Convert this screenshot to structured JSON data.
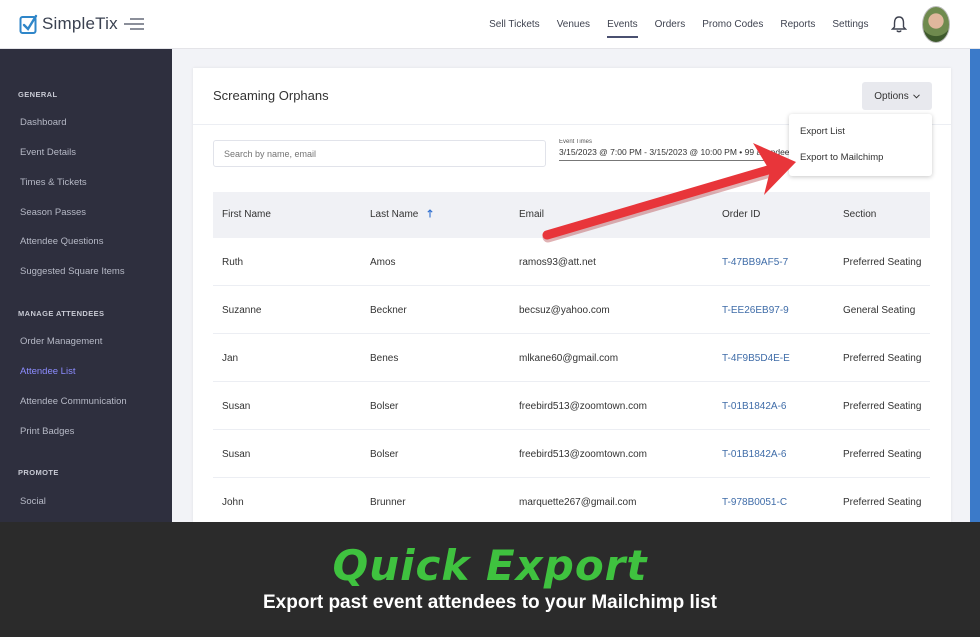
{
  "app": {
    "name": "SimpleTix"
  },
  "nav": {
    "items": [
      "Sell Tickets",
      "Venues",
      "Events",
      "Orders",
      "Promo Codes",
      "Reports",
      "Settings"
    ],
    "active": "Events"
  },
  "sidebar": {
    "sections": [
      {
        "title": "GENERAL",
        "items": [
          "Dashboard",
          "Event Details",
          "Times & Tickets",
          "Season Passes",
          "Attendee Questions",
          "Suggested Square Items"
        ]
      },
      {
        "title": "MANAGE ATTENDEES",
        "items": [
          "Order Management",
          "Attendee List",
          "Attendee Communication",
          "Print Badges"
        ]
      },
      {
        "title": "PROMOTE",
        "items": [
          "Social"
        ]
      }
    ],
    "active_item": "Attendee List"
  },
  "card": {
    "title": "Screaming Orphans",
    "options_label": "Options",
    "search_placeholder": "Search by name, email",
    "event_times_label": "Event Times",
    "event_times_value": "3/15/2023 @ 7:00 PM - 3/15/2023 @ 10:00 PM • 99 attendees"
  },
  "dropdown": {
    "items": [
      "Export List",
      "Export to Mailchimp"
    ]
  },
  "table": {
    "columns": [
      "First Name",
      "Last Name",
      "Email",
      "Order ID",
      "Section"
    ],
    "rows": [
      [
        "Ruth",
        "Amos",
        "ramos93@att.net",
        "T-47BB9AF5-7",
        "Preferred Seating"
      ],
      [
        "Suzanne",
        "Beckner",
        "becsuz@yahoo.com",
        "T-EE26EB97-9",
        "General Seating"
      ],
      [
        "Jan",
        "Benes",
        "mlkane60@gmail.com",
        "T-4F9B5D4E-E",
        "Preferred Seating"
      ],
      [
        "Susan",
        "Bolser",
        "freebird513@zoomtown.com",
        "T-01B1842A-6",
        "Preferred Seating"
      ],
      [
        "Susan",
        "Bolser",
        "freebird513@zoomtown.com",
        "T-01B1842A-6",
        "Preferred Seating"
      ],
      [
        "John",
        "Brunner",
        "marquette267@gmail.com",
        "T-978B0051-C",
        "Preferred Seating"
      ]
    ]
  },
  "banner": {
    "title": "Quick Export",
    "subtitle": "Export past event attendees to your Mailchimp list",
    "title_color": "#3fc23f"
  },
  "colors": {
    "sidebar_bg": "#2e2f3e",
    "accent_link": "#3f6ca8",
    "arrow": "#e8353a",
    "active_sidebar": "#8c8cff"
  }
}
